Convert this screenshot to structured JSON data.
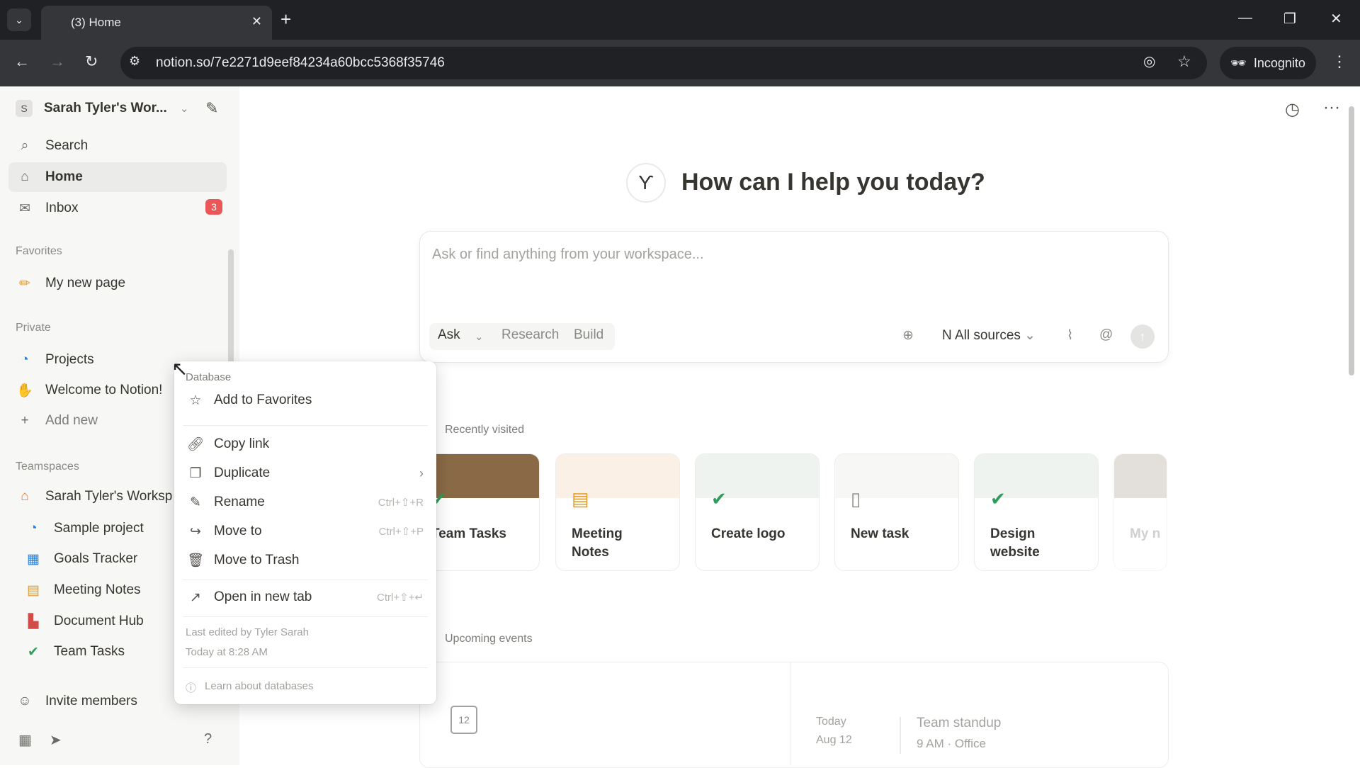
{
  "browser": {
    "tab_title": "(3) Home",
    "url": "notion.so/7e2271d9eef84234a60bcc5368f35746",
    "incognito_label": "Incognito"
  },
  "sidebar": {
    "workspace_name": "Sarah Tyler's Wor...",
    "workspace_initial": "S",
    "search": "Search",
    "home": "Home",
    "inbox": "Inbox",
    "inbox_count": "3",
    "favorites_label": "Favorites",
    "favorites": [
      "My new page"
    ],
    "private_label": "Private",
    "private": [
      "Projects",
      "Welcome to Notion!"
    ],
    "add_new": "Add new",
    "teamspaces_label": "Teamspaces",
    "teamspace_name": "Sarah Tyler's Worksp",
    "teamspace_items": [
      "Sample project",
      "Goals Tracker",
      "Meeting Notes",
      "Document Hub",
      "Team Tasks"
    ],
    "invite": "Invite members"
  },
  "main": {
    "title": "How can I help you today?",
    "ask_placeholder": "Ask or find anything from your workspace...",
    "modes": [
      "Ask",
      "Research",
      "Build"
    ],
    "sources": "All sources",
    "recently_visited_label": "Recently visited",
    "recent": [
      "Team Tasks",
      "Meeting Notes",
      "Create logo",
      "New task",
      "Design website",
      "My n"
    ],
    "upcoming_label": "Upcoming events",
    "event_day": "Today",
    "event_date": "Aug 12",
    "event_title": "Team standup",
    "event_detail": "9 AM · Office",
    "calendar_num": "12"
  },
  "context_menu": {
    "header": "Database",
    "items": [
      {
        "label": "Add to Favorites",
        "shortcut": ""
      },
      {
        "label": "Copy link",
        "shortcut": ""
      },
      {
        "label": "Duplicate",
        "shortcut": ""
      },
      {
        "label": "Rename",
        "shortcut": "Ctrl+⇧+R"
      },
      {
        "label": "Move to",
        "shortcut": "Ctrl+⇧+P"
      },
      {
        "label": "Move to Trash",
        "shortcut": ""
      },
      {
        "label": "Open in new tab",
        "shortcut": "Ctrl+⇧+↵"
      }
    ],
    "last_edited": "Last edited by Tyler Sarah",
    "edited_time": "Today at 8:28 AM",
    "learn": "Learn about databases"
  },
  "colors": {
    "accent_red": "#eb5757",
    "check_green": "#2e9d5b"
  }
}
